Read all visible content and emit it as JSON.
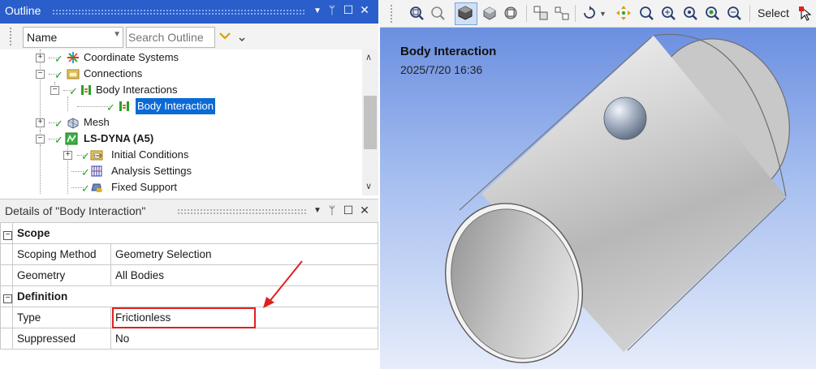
{
  "outline": {
    "title": "Outline",
    "name_select": "Name",
    "search_placeholder": "Search Outline",
    "tree": [
      {
        "label": "Coordinate Systems"
      },
      {
        "label": "Connections"
      },
      {
        "label": "Body Interactions"
      },
      {
        "label": "Body Interaction",
        "selected": true
      },
      {
        "label": "Mesh"
      },
      {
        "label": "LS-DYNA (A5)",
        "bold": true
      },
      {
        "label": "Initial Conditions"
      },
      {
        "label": "Analysis Settings"
      },
      {
        "label": "Fixed Support"
      }
    ]
  },
  "details": {
    "title": "Details of \"Body Interaction\"",
    "sections": [
      {
        "name": "Scope",
        "rows": [
          {
            "key": "Scoping Method",
            "value": "Geometry Selection"
          },
          {
            "key": "Geometry",
            "value": "All Bodies"
          }
        ]
      },
      {
        "name": "Definition",
        "rows": [
          {
            "key": "Type",
            "value": "Frictionless"
          },
          {
            "key": "Suppressed",
            "value": "No"
          }
        ]
      }
    ]
  },
  "graphics": {
    "toolbar_select_label": "Select",
    "viewport_title": "Body Interaction",
    "viewport_date": "2025/7/20 16:36"
  },
  "colors": {
    "title_bar": "#2a5ecb",
    "selection": "#0a6ad6",
    "check": "#2aa02a",
    "highlight_box": "#e02020"
  }
}
